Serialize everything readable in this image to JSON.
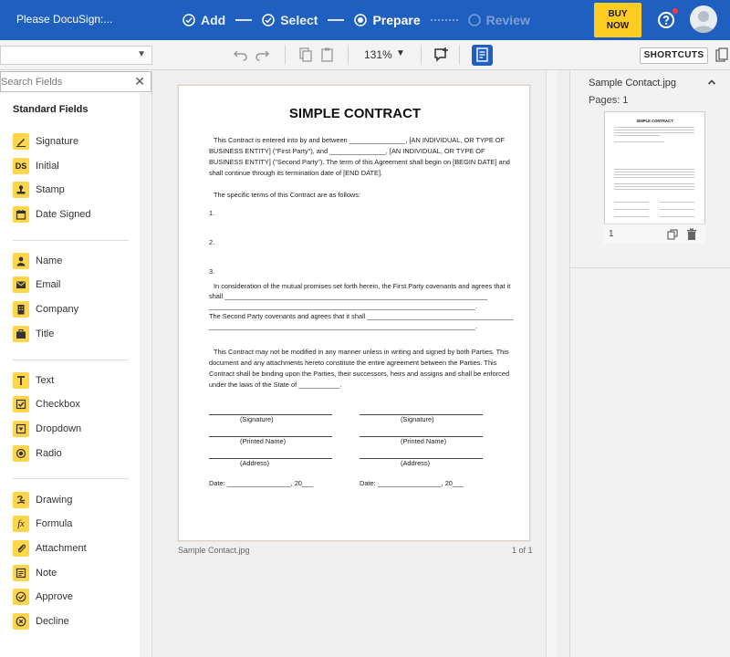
{
  "topbar": {
    "title": "Please DocuSign:...",
    "steps": [
      {
        "label": "Add",
        "state": "done"
      },
      {
        "label": "Select",
        "state": "done"
      },
      {
        "label": "Prepare",
        "state": "current"
      },
      {
        "label": "Review",
        "state": "future"
      }
    ],
    "buy_label_1": "BUY",
    "buy_label_2": "NOW",
    "colors": {
      "bar": "#1f5fbf",
      "buy": "#ffcc22",
      "notif": "#ff3b3b"
    }
  },
  "toolbar": {
    "zoom": "131%",
    "shortcuts": "SHORTCUTS"
  },
  "left": {
    "search_placeholder": "Search Fields",
    "section_title": "Standard Fields",
    "groups": [
      [
        {
          "label": "Signature",
          "icon": "signature-icon"
        },
        {
          "label": "Initial",
          "icon": "initial-icon"
        },
        {
          "label": "Stamp",
          "icon": "stamp-icon"
        },
        {
          "label": "Date Signed",
          "icon": "calendar-icon"
        }
      ],
      [
        {
          "label": "Name",
          "icon": "person-icon"
        },
        {
          "label": "Email",
          "icon": "envelope-icon"
        },
        {
          "label": "Company",
          "icon": "building-icon"
        },
        {
          "label": "Title",
          "icon": "briefcase-icon"
        }
      ],
      [
        {
          "label": "Text",
          "icon": "text-icon"
        },
        {
          "label": "Checkbox",
          "icon": "checkbox-icon"
        },
        {
          "label": "Dropdown",
          "icon": "dropdown-icon"
        },
        {
          "label": "Radio",
          "icon": "radio-icon"
        }
      ],
      [
        {
          "label": "Drawing",
          "icon": "drawing-icon"
        },
        {
          "label": "Formula",
          "icon": "formula-icon"
        },
        {
          "label": "Attachment",
          "icon": "paperclip-icon"
        },
        {
          "label": "Note",
          "icon": "note-icon"
        },
        {
          "label": "Approve",
          "icon": "approve-icon"
        },
        {
          "label": "Decline",
          "icon": "decline-icon"
        }
      ]
    ]
  },
  "document": {
    "title": "SIMPLE CONTRACT",
    "lines": {
      "p1a": "This Contract is entered into by and between _______________, [AN INDIVIDUAL, OR TYPE OF",
      "p1b": "BUSINESS ENTITY] (\"First Party\"), and _______________, [AN INDIVIDUAL, OR TYPE OF",
      "p1c": "BUSINESS ENTITY] (\"Second Party\").   The term of this Agreement shall begin on [BEGIN DATE] and",
      "p1d": "shall continue through its termination date of [END DATE].",
      "p2": "The specific terms of this Contract are as follows:",
      "n1": "1.",
      "n2": "2.",
      "n3": "3.",
      "p3a": "In consideration of the mutual promises set forth herein, the First Party covenants and agrees that it",
      "p3b": "shall ______________________________________________________________________",
      "p3c": "_______________________________________________________________________.",
      "p3d": "The Second Party covenants and agrees that it shall _______________________________________",
      "p3e": "_______________________________________________________________________.",
      "p4a": "This Contract may not be modified in any manner unless in writing and signed by both Parties.  This",
      "p4b": "document and any attachments hereto constitute the entire agreement between the Parties.  This",
      "p4c": "Contract shall be binding upon the Parties, their successors, heirs and assigns and shall be enforced",
      "p4d": "under the laws of the State of ___________.",
      "sig": "(Signature)",
      "printed": "(Printed Name)",
      "address": "(Address)",
      "date": "Date: _________________, 20___"
    },
    "footer_name": "Sample Contact.jpg",
    "footer_page": "1 of 1"
  },
  "right": {
    "doc_name": "Sample Contact.jpg",
    "pages": "Pages: 1",
    "thumb_title": "SIMPLE CONTRACT",
    "thumb_num": "1"
  }
}
